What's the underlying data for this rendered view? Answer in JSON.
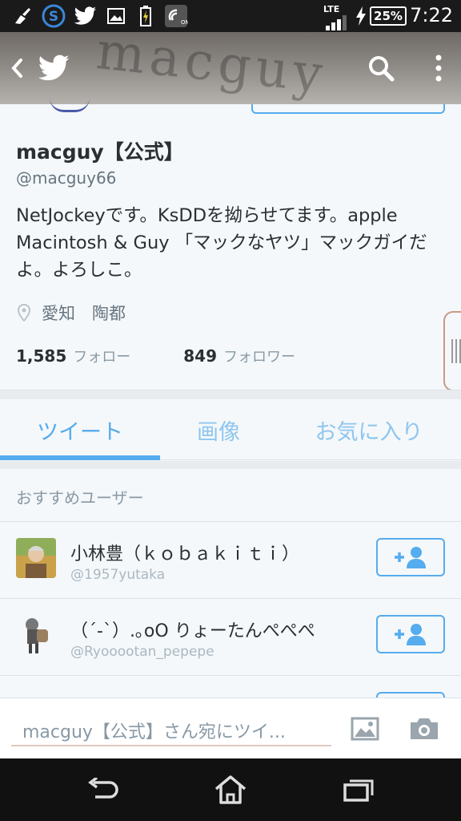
{
  "statusbar": {
    "network": "LTE",
    "battery": "25%",
    "time": "7:22"
  },
  "header": {
    "banner_scribble": "macguy"
  },
  "profile": {
    "name": "macguy【公式】",
    "handle": "@macguy66",
    "bio": "NetJockeyです。KsDDを拗らせてます。apple Macintosh & Guy 「マックなヤツ」マックガイだよ。よろしこ。",
    "location": "愛知　陶都",
    "following_count": "1,585",
    "following_label": "フォロー",
    "followers_count": "849",
    "followers_label": "フォロワー"
  },
  "tabs": [
    {
      "label": "ツイート",
      "active": true
    },
    {
      "label": "画像",
      "active": false
    },
    {
      "label": "お気に入り",
      "active": false
    }
  ],
  "suggested": {
    "title": "おすすめユーザー",
    "users": [
      {
        "name": "小林豊（ｋｏｂａｋｉｔｉ）",
        "handle": "@1957yutaka"
      },
      {
        "name": "（´-`）.｡oO りょーたんぺぺぺ",
        "handle": "@Ryooootan_pepepe"
      },
      {
        "name": "",
        "handle": ""
      }
    ]
  },
  "compose": {
    "placeholder": "macguy【公式】さん宛にツイ..."
  },
  "colors": {
    "accent": "#55acee",
    "text": "#292f33",
    "muted": "#8899a6"
  }
}
